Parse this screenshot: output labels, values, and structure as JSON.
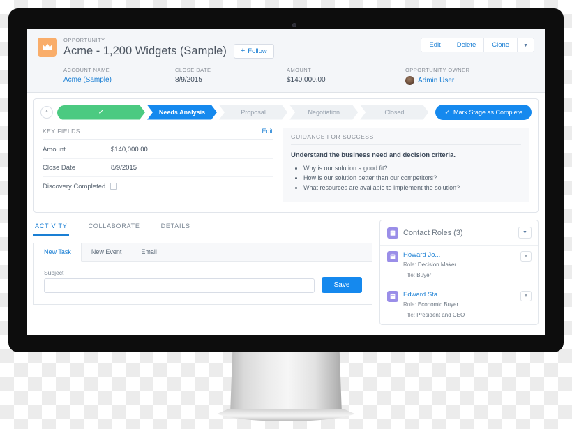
{
  "device": {
    "type": "imac-monitor",
    "webcam": "webcam-dot"
  },
  "header": {
    "icon": "crown-icon",
    "eyebrow": "OPPORTUNITY",
    "title": "Acme - 1,200 Widgets (Sample)",
    "follow_label": "Follow",
    "follow_plus": "+",
    "actions": [
      "Edit",
      "Delete",
      "Clone"
    ],
    "actions_caret": "▼",
    "fields": [
      {
        "label": "ACCOUNT NAME",
        "value": "Acme (Sample)",
        "is_link": true
      },
      {
        "label": "CLOSE DATE",
        "value": "8/9/2015",
        "is_link": false
      },
      {
        "label": "AMOUNT",
        "value": "$140,000.00",
        "is_link": false
      }
    ],
    "owner": {
      "label": "OPPORTUNITY OWNER",
      "value": "Admin User",
      "avatar": "user-avatar"
    }
  },
  "path": {
    "collapse_icon": "chevron-up-icon",
    "stages": [
      {
        "label": "",
        "state": "done",
        "tick": "✓"
      },
      {
        "label": "Needs Analysis",
        "state": "current"
      },
      {
        "label": "Proposal",
        "state": "upcoming"
      },
      {
        "label": "Negotiation",
        "state": "upcoming"
      },
      {
        "label": "Closed",
        "state": "upcoming"
      }
    ],
    "mark_complete_label": "Mark Stage as Complete",
    "mark_complete_tick": "✓",
    "colors": {
      "done": "#4bca81",
      "current": "#1589ee",
      "upcoming": "#eef1f4",
      "accent": "#1589ee"
    }
  },
  "key_fields": {
    "title": "KEY FIELDS",
    "edit_label": "Edit",
    "rows": [
      {
        "name": "Amount",
        "value": "$140,000.00",
        "type": "text"
      },
      {
        "name": "Close Date",
        "value": "8/9/2015",
        "type": "text"
      },
      {
        "name": "Discovery Completed",
        "value": "",
        "type": "checkbox",
        "checked": false
      }
    ]
  },
  "guidance": {
    "title": "GUIDANCE FOR SUCCESS",
    "lead": "Understand the business need and decision criteria.",
    "bullets": [
      "Why is our solution a good fit?",
      "How is our solution better than our competitors?",
      "What resources are available to implement the solution?"
    ]
  },
  "activity": {
    "tabs": [
      {
        "label": "ACTIVITY",
        "active": true
      },
      {
        "label": "COLLABORATE",
        "active": false
      },
      {
        "label": "DETAILS",
        "active": false
      }
    ],
    "subtabs": [
      {
        "label": "New Task",
        "active": true
      },
      {
        "label": "New Event",
        "active": false
      },
      {
        "label": "Email",
        "active": false
      }
    ],
    "subject_label": "Subject",
    "subject_value": "",
    "subject_placeholder": "",
    "save_label": "Save"
  },
  "contact_roles": {
    "icon": "contact-roles-icon",
    "title": "Contact Roles (3)",
    "disclosure_icon": "▼",
    "items": [
      {
        "icon": "contact-icon",
        "name": "Howard Jo...",
        "role_label": "Role:",
        "role_value": "Decision Maker",
        "title_label": "Title:",
        "title_value": "Buyer"
      },
      {
        "icon": "contact-icon",
        "name": "Edward Sta...",
        "role_label": "Role:",
        "role_value": "Economic Buyer",
        "title_label": "Title:",
        "title_value": "President and CEO"
      }
    ]
  }
}
